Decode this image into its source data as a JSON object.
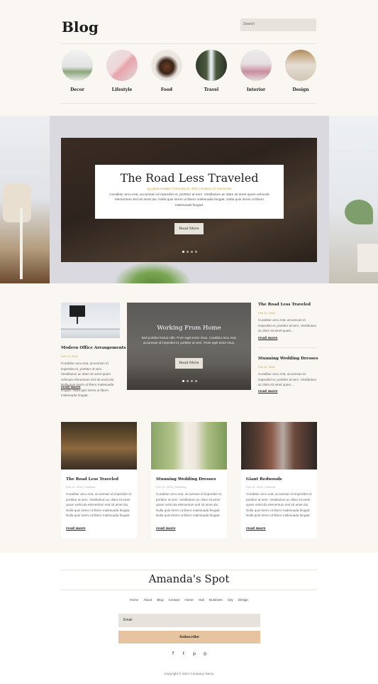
{
  "header": {
    "title": "Blog",
    "search_placeholder": "Search"
  },
  "categories": [
    {
      "label": "Decor",
      "icon": "decor-photo"
    },
    {
      "label": "Lifestyle",
      "icon": "lifestyle-photo"
    },
    {
      "label": "Food",
      "icon": "food-photo"
    },
    {
      "label": "Travel",
      "icon": "travel-photo"
    },
    {
      "label": "Interior",
      "icon": "interior-photo"
    },
    {
      "label": "Design",
      "icon": "design-photo"
    }
  ],
  "hero": {
    "title": "The Road Less Traveled",
    "meta": "by paula remaker | February 12, 2016 | Outdoor | 0 Comments",
    "excerpt": "Curabitur arcu erat, accumsan id imperdiet et, porttitor at sem. Vestibulum ac diam sit amet quam vehicula elementum sed sit amet dui. Nulla quis lorem ut libero malesuada feugiat. Nulla quis lorem ut libero malesuada feugiat.",
    "button": "Read More"
  },
  "featured_left": {
    "title": "Modern Office Arrangements",
    "date": "Feb 12, 2016",
    "excerpt": "Curabitur arcu erat, accumsan id imperdiet et, porttitor at sem. Vestibulum ac diam sit amet quam vehicula elementum sed sit amet dui. Nulla quis lorem ut libero malesuada feugiat. Nulla quis lorem ut libero malesuada feugiat.",
    "read_more": "read more"
  },
  "featured_center": {
    "title": "Working From Home",
    "excerpt": "Sed porttitor lectus nibh. Proin eget tortor risus. Curabitur arcu erat, accumsan id imperdiet et, porttitor at sem. Proin eget tortor risus.",
    "button": "Read More"
  },
  "featured_right": [
    {
      "title": "The Road Less Traveled",
      "date": "Feb 12, 2016",
      "excerpt": "Curabitur arcu erat, accumsan id imperdiet et, porttitor at sem. Vestibulum ac diam sit amet quam...",
      "read_more": "read more"
    },
    {
      "title": "Stunning Wedding Dresses",
      "date": "Feb 12, 2016",
      "excerpt": "Curabitur arcu erat, accumsan id imperdiet et, porttitor at sem. Vestibulum ac diam sit amet quam...",
      "read_more": "read more"
    }
  ],
  "cards": [
    {
      "title": "The Road Less Traveled",
      "meta": "Feb 12, 2016 | Outdoor",
      "excerpt": "Curabitur arcu erat, accumsan id imperdiet et, porttitor at sem. Vestibulum ac diam sit amet quam vehicula elementum sed sit amet dui. Nulla quis lorem ut libero malesuada feugiat. Nulla quis lorem ut libero malesuada feugiat.",
      "read_more": "read more"
    },
    {
      "title": "Stunning Wedding Dresses",
      "meta": "Feb 12, 2016 | Wedding",
      "excerpt": "Curabitur arcu erat, accumsan id imperdiet et, porttitor at sem. Vestibulum ac diam sit amet quam vehicula elementum sed sit amet dui. Nulla quis lorem ut libero malesuada feugiat. Nulla quis lorem ut libero malesuada feugiat.",
      "read_more": "read more"
    },
    {
      "title": "Giant Redwoods",
      "meta": "Feb 12, 2016 | Outdoor",
      "excerpt": "Curabitur arcu erat, accumsan id imperdiet et, porttitor at sem. Vestibulum ac diam sit amet quam vehicula elementum sed sit amet dui. Nulla quis lorem ut libero malesuada feugiat. Nulla quis lorem ut libero malesuada feugiat.",
      "read_more": "read more"
    }
  ],
  "footer": {
    "site_name": "Amanda's Spot",
    "nav": [
      "Home",
      "About",
      "Blog",
      "Contact",
      "Home",
      "Hub",
      "Business",
      "City",
      "Design"
    ],
    "email_placeholder": "Email",
    "subscribe": "Subscribe",
    "socials": [
      {
        "icon": "facebook-icon",
        "glyph": "f"
      },
      {
        "icon": "twitter-icon",
        "glyph": "t"
      },
      {
        "icon": "pinterest-icon",
        "glyph": "p"
      },
      {
        "icon": "instagram-icon",
        "glyph": "◎"
      }
    ],
    "copyright": "Copyright © 2021 Company Name"
  },
  "colors": {
    "accent": "#c79b45",
    "subscribe": "#e5c49f",
    "background": "#faf7f2"
  }
}
